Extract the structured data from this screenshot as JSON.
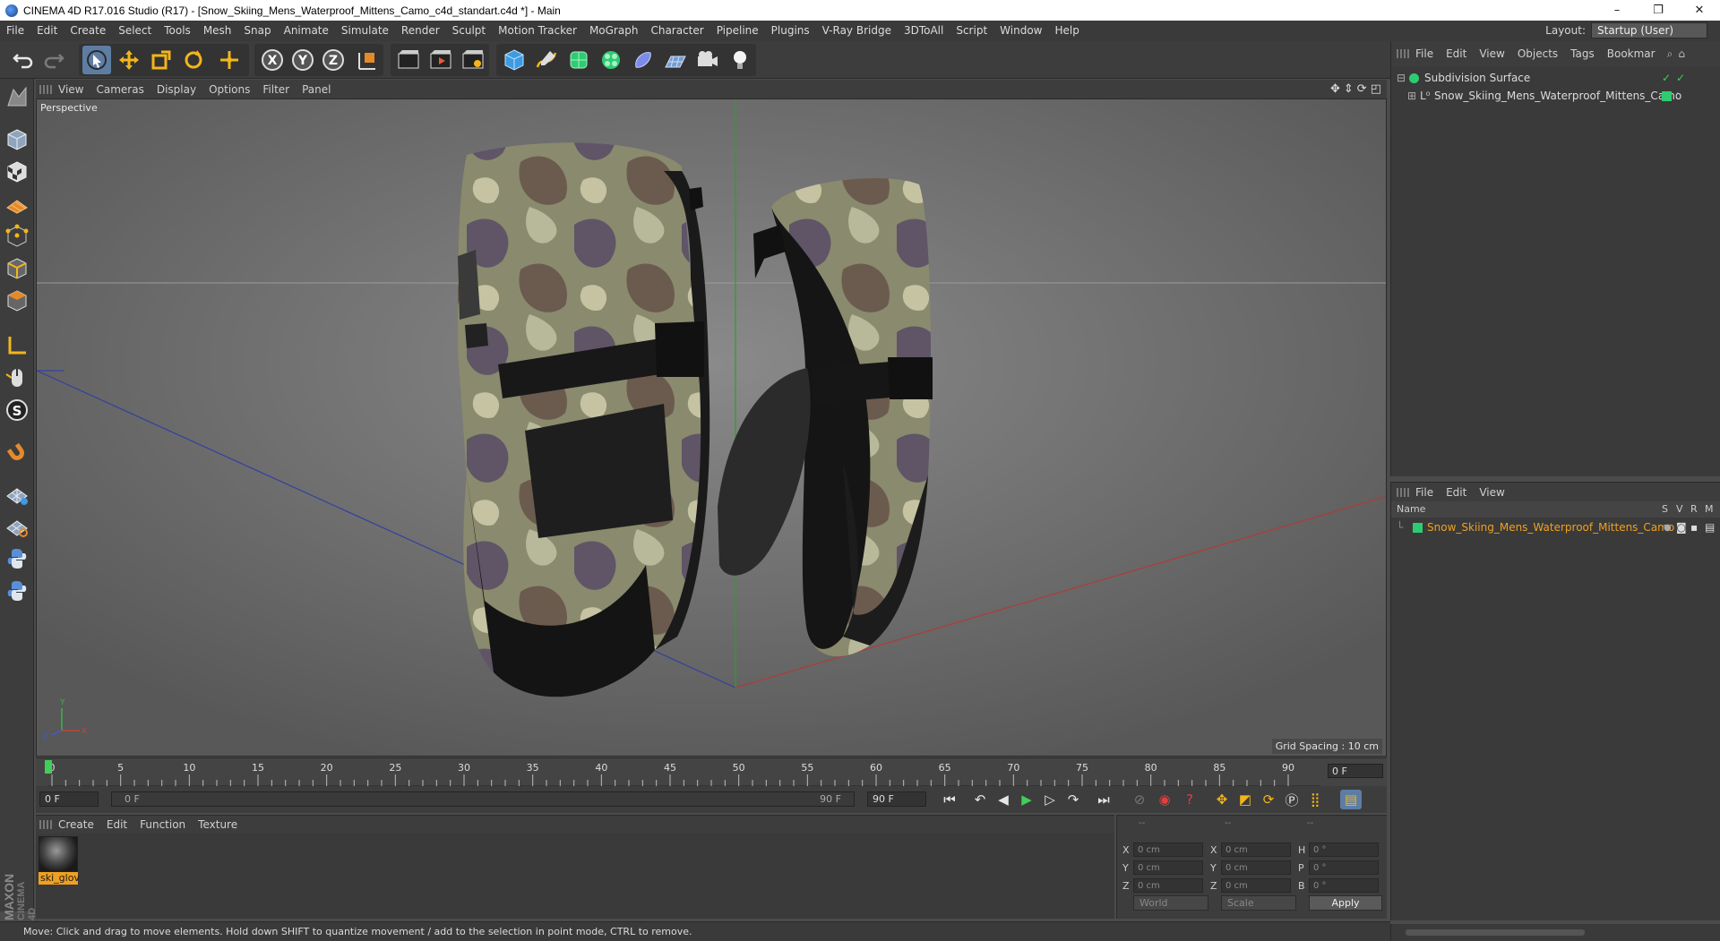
{
  "window": {
    "title": "CINEMA 4D R17.016 Studio (R17) - [Snow_Skiing_Mens_Waterproof_Mittens_Camo_c4d_standart.c4d *] - Main",
    "minimize": "–",
    "maximize": "❐",
    "close": "✕"
  },
  "menu": {
    "items": [
      "File",
      "Edit",
      "Create",
      "Select",
      "Tools",
      "Mesh",
      "Snap",
      "Animate",
      "Simulate",
      "Render",
      "Sculpt",
      "Motion Tracker",
      "MoGraph",
      "Character",
      "Pipeline",
      "Plugins",
      "V-Ray Bridge",
      "3DToAll",
      "Script",
      "Window",
      "Help"
    ],
    "layout_label": "Layout:",
    "layout_value": "Startup (User)"
  },
  "viewport": {
    "menu": [
      "View",
      "Cameras",
      "Display",
      "Options",
      "Filter",
      "Panel"
    ],
    "camera_label": "Perspective",
    "grid_spacing": "Grid Spacing : 10 cm"
  },
  "timeline": {
    "ticks": [
      "0",
      "5",
      "10",
      "15",
      "20",
      "25",
      "30",
      "35",
      "40",
      "45",
      "50",
      "55",
      "60",
      "65",
      "70",
      "75",
      "80",
      "85",
      "90"
    ],
    "current_frame": "0 F"
  },
  "transport": {
    "start_field": "0 F",
    "range_start": "0 F",
    "range_end": "90 F",
    "end_field": "90 F"
  },
  "materials": {
    "menu": [
      "Create",
      "Edit",
      "Function",
      "Texture"
    ],
    "items": [
      {
        "name": "ski_glov"
      }
    ]
  },
  "coords": {
    "headers": [
      "--",
      "--",
      "--"
    ],
    "rows": [
      {
        "a": "X",
        "v1": "0 cm",
        "b": "X",
        "v2": "0 cm",
        "c": "H",
        "v3": "0 °"
      },
      {
        "a": "Y",
        "v1": "0 cm",
        "b": "Y",
        "v2": "0 cm",
        "c": "P",
        "v3": "0 °"
      },
      {
        "a": "Z",
        "v1": "0 cm",
        "b": "Z",
        "v2": "0 cm",
        "c": "B",
        "v3": "0 °"
      }
    ],
    "mode1": "World",
    "mode2": "Scale",
    "apply": "Apply"
  },
  "status": "Move: Click and drag to move elements. Hold down SHIFT to quantize movement / add to the selection in point mode, CTRL to remove.",
  "objects": {
    "menu": [
      "File",
      "Edit",
      "View",
      "Objects",
      "Tags",
      "Bookmar"
    ],
    "items": [
      {
        "name": "Subdivision Surface"
      },
      {
        "name": "Snow_Skiing_Mens_Waterproof_Mittens_Camo"
      }
    ]
  },
  "layers": {
    "menu": [
      "File",
      "Edit",
      "View"
    ],
    "header_name": "Name",
    "header_cols": [
      "S",
      "V",
      "R",
      "M"
    ],
    "items": [
      {
        "name": "Snow_Skiing_Mens_Waterproof_Mittens_Camo"
      }
    ]
  },
  "branding": {
    "line1": "MAXON",
    "line2": "CINEMA 4D"
  },
  "colors": {
    "accent_orange": "#f0a020",
    "selection_blue": "#5e7da3",
    "layer_green": "#2ecc71"
  }
}
